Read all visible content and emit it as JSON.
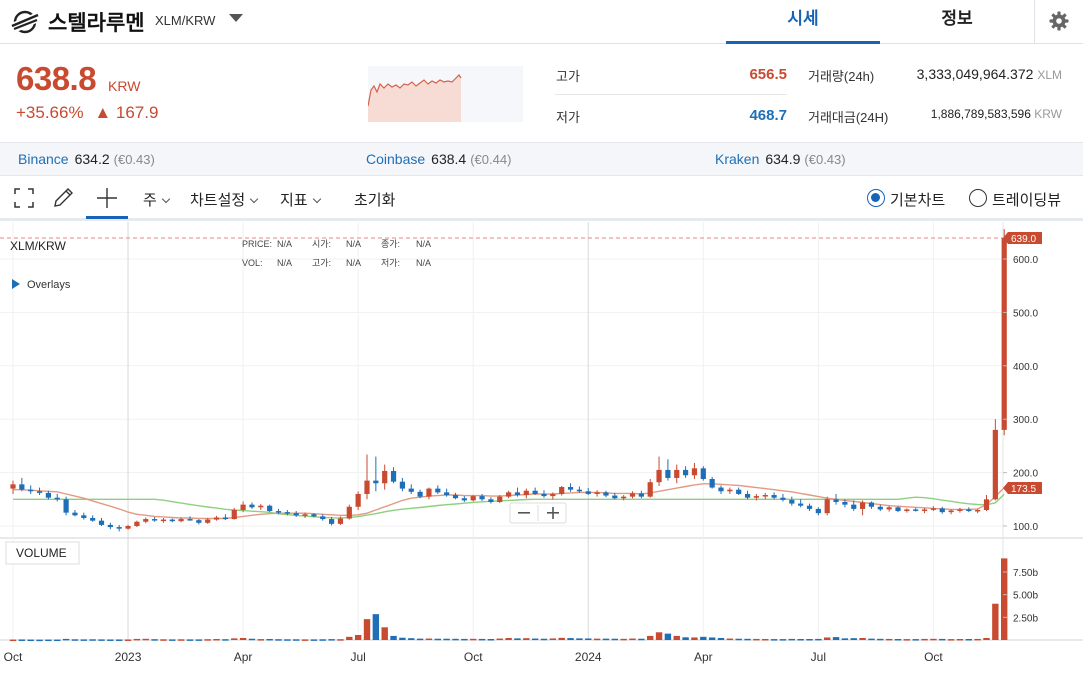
{
  "header": {
    "coin_name": "스텔라루멘",
    "pair": "XLM/KRW",
    "tabs": [
      "시세",
      "정보"
    ]
  },
  "summary": {
    "price": "638.8",
    "currency": "KRW",
    "change_pct": "+35.66%",
    "change_abs": "▲ 167.9",
    "high_label": "고가",
    "high_value": "656.5",
    "low_label": "저가",
    "low_value": "468.7",
    "volume_label": "거래량(24h)",
    "volume_value": "3,333,049,964.372",
    "volume_unit": "XLM",
    "amount_label": "거래대금(24H)",
    "amount_value": "1,886,789,583,596",
    "amount_unit": "KRW"
  },
  "exchanges": [
    {
      "name": "Binance",
      "price": "634.2",
      "eur": "(€0.43)"
    },
    {
      "name": "Coinbase",
      "price": "638.4",
      "eur": "(€0.44)"
    },
    {
      "name": "Kraken",
      "price": "634.9",
      "eur": "(€0.43)"
    }
  ],
  "toolbar": {
    "period": "주",
    "chart_settings": "차트설정",
    "indicators": "지표",
    "reset": "초기화",
    "basic_chart": "기본차트",
    "tradingview": "트레이딩뷰"
  },
  "colors": {
    "up": "#c84a31",
    "down": "#1f6fb8",
    "ma_short": "#e39a83",
    "ma_long": "#8ed07f",
    "accent": "#1763b6"
  },
  "chart_data": {
    "type": "candlestick",
    "symbol": "XLM/KRW",
    "ohlc_labels": {
      "price": "PRICE:",
      "open": "시가:",
      "close": "종가:",
      "volume": "VOL:",
      "high": "고가:",
      "low": "저가:",
      "na": "N/A"
    },
    "overlays_label": "Overlays",
    "volume_label": "VOLUME",
    "last_price_tag": "639.0",
    "ma_tag": "173.5",
    "y_ticks": [
      "600.0",
      "500.0",
      "400.0",
      "300.0",
      "200.0",
      "100.0"
    ],
    "y_tick_values": [
      600,
      500,
      400,
      300,
      200,
      100
    ],
    "volume_ticks": [
      "7.50b",
      "5.00b",
      "2.50b"
    ],
    "volume_tick_values": [
      7.5,
      5.0,
      2.5
    ],
    "x_ticks": [
      {
        "label": "Oct",
        "i": 0
      },
      {
        "label": "2023",
        "i": 13
      },
      {
        "label": "Apr",
        "i": 26
      },
      {
        "label": "Jul",
        "i": 39
      },
      {
        "label": "Oct",
        "i": 52
      },
      {
        "label": "2024",
        "i": 65
      },
      {
        "label": "Apr",
        "i": 78
      },
      {
        "label": "Jul",
        "i": 91
      },
      {
        "label": "Oct",
        "i": 104
      }
    ],
    "candles": [
      {
        "o": 170,
        "h": 185,
        "l": 160,
        "c": 178,
        "v": 0.05
      },
      {
        "o": 178,
        "h": 190,
        "l": 165,
        "c": 168,
        "v": 0.06
      },
      {
        "o": 168,
        "h": 176,
        "l": 160,
        "c": 165,
        "v": 0.05
      },
      {
        "o": 165,
        "h": 172,
        "l": 158,
        "c": 162,
        "v": 0.04
      },
      {
        "o": 162,
        "h": 166,
        "l": 150,
        "c": 153,
        "v": 0.05
      },
      {
        "o": 153,
        "h": 160,
        "l": 146,
        "c": 150,
        "v": 0.05
      },
      {
        "o": 150,
        "h": 155,
        "l": 120,
        "c": 125,
        "v": 0.12
      },
      {
        "o": 125,
        "h": 130,
        "l": 118,
        "c": 120,
        "v": 0.08
      },
      {
        "o": 120,
        "h": 125,
        "l": 112,
        "c": 115,
        "v": 0.07
      },
      {
        "o": 115,
        "h": 120,
        "l": 108,
        "c": 110,
        "v": 0.08
      },
      {
        "o": 110,
        "h": 115,
        "l": 100,
        "c": 102,
        "v": 0.07
      },
      {
        "o": 102,
        "h": 106,
        "l": 94,
        "c": 98,
        "v": 0.06
      },
      {
        "o": 98,
        "h": 102,
        "l": 90,
        "c": 95,
        "v": 0.06
      },
      {
        "o": 95,
        "h": 102,
        "l": 93,
        "c": 100,
        "v": 0.06
      },
      {
        "o": 100,
        "h": 110,
        "l": 98,
        "c": 108,
        "v": 0.12
      },
      {
        "o": 108,
        "h": 116,
        "l": 105,
        "c": 113,
        "v": 0.13
      },
      {
        "o": 113,
        "h": 117,
        "l": 108,
        "c": 111,
        "v": 0.09
      },
      {
        "o": 111,
        "h": 115,
        "l": 106,
        "c": 112,
        "v": 0.08
      },
      {
        "o": 112,
        "h": 114,
        "l": 107,
        "c": 109,
        "v": 0.07
      },
      {
        "o": 109,
        "h": 116,
        "l": 107,
        "c": 113,
        "v": 0.08
      },
      {
        "o": 113,
        "h": 118,
        "l": 110,
        "c": 111,
        "v": 0.07
      },
      {
        "o": 111,
        "h": 113,
        "l": 103,
        "c": 106,
        "v": 0.07
      },
      {
        "o": 106,
        "h": 115,
        "l": 104,
        "c": 112,
        "v": 0.09
      },
      {
        "o": 112,
        "h": 119,
        "l": 110,
        "c": 116,
        "v": 0.11
      },
      {
        "o": 116,
        "h": 122,
        "l": 111,
        "c": 113,
        "v": 0.09
      },
      {
        "o": 113,
        "h": 134,
        "l": 112,
        "c": 130,
        "v": 0.18
      },
      {
        "o": 130,
        "h": 146,
        "l": 126,
        "c": 140,
        "v": 0.22
      },
      {
        "o": 140,
        "h": 144,
        "l": 132,
        "c": 135,
        "v": 0.14
      },
      {
        "o": 135,
        "h": 141,
        "l": 130,
        "c": 138,
        "v": 0.1
      },
      {
        "o": 138,
        "h": 140,
        "l": 126,
        "c": 128,
        "v": 0.11
      },
      {
        "o": 128,
        "h": 132,
        "l": 122,
        "c": 126,
        "v": 0.09
      },
      {
        "o": 126,
        "h": 130,
        "l": 120,
        "c": 124,
        "v": 0.08
      },
      {
        "o": 124,
        "h": 128,
        "l": 117,
        "c": 120,
        "v": 0.08
      },
      {
        "o": 120,
        "h": 125,
        "l": 115,
        "c": 122,
        "v": 0.07
      },
      {
        "o": 122,
        "h": 124,
        "l": 116,
        "c": 118,
        "v": 0.07
      },
      {
        "o": 118,
        "h": 122,
        "l": 110,
        "c": 113,
        "v": 0.08
      },
      {
        "o": 113,
        "h": 117,
        "l": 101,
        "c": 104,
        "v": 0.1
      },
      {
        "o": 104,
        "h": 118,
        "l": 102,
        "c": 114,
        "v": 0.09
      },
      {
        "o": 114,
        "h": 140,
        "l": 112,
        "c": 136,
        "v": 0.35
      },
      {
        "o": 136,
        "h": 165,
        "l": 130,
        "c": 160,
        "v": 0.55
      },
      {
        "o": 160,
        "h": 234,
        "l": 150,
        "c": 185,
        "v": 2.3
      },
      {
        "o": 185,
        "h": 230,
        "l": 165,
        "c": 180,
        "v": 2.85
      },
      {
        "o": 180,
        "h": 215,
        "l": 168,
        "c": 203,
        "v": 1.4
      },
      {
        "o": 203,
        "h": 210,
        "l": 180,
        "c": 183,
        "v": 0.45
      },
      {
        "o": 183,
        "h": 190,
        "l": 165,
        "c": 170,
        "v": 0.25
      },
      {
        "o": 170,
        "h": 178,
        "l": 160,
        "c": 164,
        "v": 0.2
      },
      {
        "o": 164,
        "h": 168,
        "l": 152,
        "c": 155,
        "v": 0.15
      },
      {
        "o": 155,
        "h": 172,
        "l": 150,
        "c": 170,
        "v": 0.16
      },
      {
        "o": 170,
        "h": 176,
        "l": 160,
        "c": 163,
        "v": 0.14
      },
      {
        "o": 163,
        "h": 170,
        "l": 155,
        "c": 158,
        "v": 0.14
      },
      {
        "o": 158,
        "h": 162,
        "l": 150,
        "c": 152,
        "v": 0.13
      },
      {
        "o": 152,
        "h": 156,
        "l": 145,
        "c": 148,
        "v": 0.12
      },
      {
        "o": 148,
        "h": 158,
        "l": 146,
        "c": 156,
        "v": 0.13
      },
      {
        "o": 156,
        "h": 160,
        "l": 147,
        "c": 150,
        "v": 0.12
      },
      {
        "o": 150,
        "h": 154,
        "l": 142,
        "c": 145,
        "v": 0.11
      },
      {
        "o": 145,
        "h": 158,
        "l": 143,
        "c": 155,
        "v": 0.16
      },
      {
        "o": 155,
        "h": 166,
        "l": 152,
        "c": 163,
        "v": 0.22
      },
      {
        "o": 163,
        "h": 172,
        "l": 155,
        "c": 158,
        "v": 0.18
      },
      {
        "o": 158,
        "h": 170,
        "l": 152,
        "c": 166,
        "v": 0.2
      },
      {
        "o": 166,
        "h": 172,
        "l": 158,
        "c": 160,
        "v": 0.16
      },
      {
        "o": 160,
        "h": 167,
        "l": 153,
        "c": 156,
        "v": 0.14
      },
      {
        "o": 156,
        "h": 163,
        "l": 150,
        "c": 160,
        "v": 0.17
      },
      {
        "o": 160,
        "h": 175,
        "l": 157,
        "c": 173,
        "v": 0.24
      },
      {
        "o": 173,
        "h": 180,
        "l": 164,
        "c": 168,
        "v": 0.21
      },
      {
        "o": 168,
        "h": 174,
        "l": 162,
        "c": 165,
        "v": 0.18
      },
      {
        "o": 165,
        "h": 171,
        "l": 158,
        "c": 160,
        "v": 0.17
      },
      {
        "o": 160,
        "h": 167,
        "l": 155,
        "c": 163,
        "v": 0.15
      },
      {
        "o": 163,
        "h": 166,
        "l": 154,
        "c": 157,
        "v": 0.15
      },
      {
        "o": 157,
        "h": 162,
        "l": 150,
        "c": 152,
        "v": 0.14
      },
      {
        "o": 152,
        "h": 158,
        "l": 148,
        "c": 155,
        "v": 0.13
      },
      {
        "o": 155,
        "h": 165,
        "l": 152,
        "c": 161,
        "v": 0.16
      },
      {
        "o": 161,
        "h": 166,
        "l": 152,
        "c": 155,
        "v": 0.14
      },
      {
        "o": 155,
        "h": 188,
        "l": 153,
        "c": 182,
        "v": 0.45
      },
      {
        "o": 182,
        "h": 230,
        "l": 175,
        "c": 205,
        "v": 0.85
      },
      {
        "o": 205,
        "h": 225,
        "l": 185,
        "c": 190,
        "v": 0.7
      },
      {
        "o": 190,
        "h": 215,
        "l": 180,
        "c": 205,
        "v": 0.45
      },
      {
        "o": 205,
        "h": 212,
        "l": 190,
        "c": 195,
        "v": 0.3
      },
      {
        "o": 195,
        "h": 218,
        "l": 188,
        "c": 208,
        "v": 0.28
      },
      {
        "o": 208,
        "h": 212,
        "l": 185,
        "c": 188,
        "v": 0.35
      },
      {
        "o": 188,
        "h": 192,
        "l": 170,
        "c": 172,
        "v": 0.28
      },
      {
        "o": 172,
        "h": 176,
        "l": 160,
        "c": 165,
        "v": 0.22
      },
      {
        "o": 165,
        "h": 172,
        "l": 160,
        "c": 168,
        "v": 0.16
      },
      {
        "o": 168,
        "h": 172,
        "l": 158,
        "c": 160,
        "v": 0.14
      },
      {
        "o": 160,
        "h": 166,
        "l": 150,
        "c": 153,
        "v": 0.13
      },
      {
        "o": 153,
        "h": 160,
        "l": 148,
        "c": 156,
        "v": 0.12
      },
      {
        "o": 156,
        "h": 162,
        "l": 150,
        "c": 158,
        "v": 0.11
      },
      {
        "o": 158,
        "h": 163,
        "l": 150,
        "c": 153,
        "v": 0.1
      },
      {
        "o": 153,
        "h": 160,
        "l": 146,
        "c": 149,
        "v": 0.1
      },
      {
        "o": 149,
        "h": 155,
        "l": 138,
        "c": 142,
        "v": 0.12
      },
      {
        "o": 142,
        "h": 150,
        "l": 135,
        "c": 138,
        "v": 0.11
      },
      {
        "o": 138,
        "h": 142,
        "l": 128,
        "c": 132,
        "v": 0.11
      },
      {
        "o": 132,
        "h": 135,
        "l": 120,
        "c": 124,
        "v": 0.12
      },
      {
        "o": 124,
        "h": 155,
        "l": 120,
        "c": 150,
        "v": 0.28
      },
      {
        "o": 150,
        "h": 160,
        "l": 140,
        "c": 145,
        "v": 0.32
      },
      {
        "o": 145,
        "h": 150,
        "l": 135,
        "c": 140,
        "v": 0.18
      },
      {
        "o": 140,
        "h": 148,
        "l": 128,
        "c": 132,
        "v": 0.2
      },
      {
        "o": 132,
        "h": 148,
        "l": 120,
        "c": 144,
        "v": 0.22
      },
      {
        "o": 144,
        "h": 146,
        "l": 132,
        "c": 136,
        "v": 0.15
      },
      {
        "o": 136,
        "h": 140,
        "l": 128,
        "c": 131,
        "v": 0.13
      },
      {
        "o": 131,
        "h": 138,
        "l": 127,
        "c": 135,
        "v": 0.12
      },
      {
        "o": 135,
        "h": 137,
        "l": 126,
        "c": 128,
        "v": 0.11
      },
      {
        "o": 128,
        "h": 133,
        "l": 125,
        "c": 131,
        "v": 0.1
      },
      {
        "o": 131,
        "h": 134,
        "l": 127,
        "c": 129,
        "v": 0.1
      },
      {
        "o": 129,
        "h": 134,
        "l": 124,
        "c": 131,
        "v": 0.12
      },
      {
        "o": 131,
        "h": 137,
        "l": 128,
        "c": 133,
        "v": 0.13
      },
      {
        "o": 133,
        "h": 136,
        "l": 123,
        "c": 126,
        "v": 0.12
      },
      {
        "o": 126,
        "h": 131,
        "l": 122,
        "c": 129,
        "v": 0.1
      },
      {
        "o": 129,
        "h": 134,
        "l": 125,
        "c": 131,
        "v": 0.11
      },
      {
        "o": 131,
        "h": 135,
        "l": 126,
        "c": 128,
        "v": 0.11
      },
      {
        "o": 128,
        "h": 132,
        "l": 124,
        "c": 130,
        "v": 0.12
      },
      {
        "o": 130,
        "h": 158,
        "l": 128,
        "c": 150,
        "v": 0.22
      },
      {
        "o": 150,
        "h": 300,
        "l": 148,
        "c": 280,
        "v": 4.0
      },
      {
        "o": 280,
        "h": 656,
        "l": 270,
        "c": 639,
        "v": 9.0
      }
    ],
    "ma_short": [
      168,
      168,
      167,
      166,
      165,
      164,
      160,
      156,
      152,
      147,
      142,
      137,
      132,
      126,
      122,
      120,
      118,
      117,
      116,
      115,
      115,
      114,
      114,
      114,
      114,
      116,
      118,
      120,
      122,
      123,
      124,
      124,
      124,
      124,
      123,
      122,
      121,
      120,
      120,
      121,
      124,
      130,
      136,
      142,
      148,
      152,
      154,
      156,
      157,
      158,
      158,
      157,
      157,
      157,
      156,
      156,
      157,
      158,
      159,
      160,
      160,
      160,
      161,
      162,
      163,
      163,
      163,
      162,
      161,
      161,
      161,
      160,
      162,
      165,
      168,
      171,
      174,
      177,
      179,
      179,
      178,
      177,
      176,
      174,
      172,
      170,
      168,
      166,
      164,
      161,
      158,
      155,
      152,
      150,
      148,
      146,
      144,
      142,
      140,
      138,
      137,
      136,
      135,
      134,
      133,
      132,
      131,
      131,
      131,
      132,
      140,
      155,
      172
    ]
  }
}
